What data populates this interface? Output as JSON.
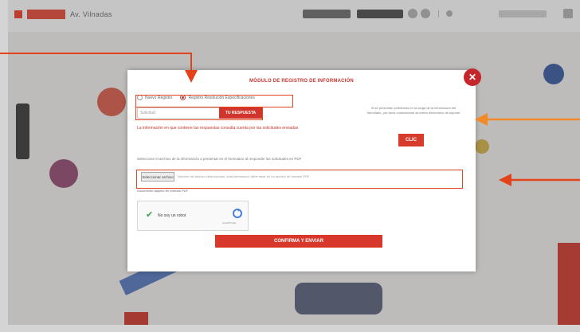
{
  "header": {
    "brand_title": "Av. Vilnadas",
    "icons": [
      "gear-icon",
      "globe-icon",
      "share-icon"
    ]
  },
  "modal": {
    "title": "MÓDULO DE REGISTRO DE INFORMACIÓN",
    "radio_options": [
      "Nuevo Registro",
      "Registro Resolución Especificaciones"
    ],
    "code_placeholder": "Solicitud",
    "code_button": "TU RESPUESTA",
    "red_note": "La información en que contiene las respuestas consulta cuenta por las solicitudes enviadas",
    "side_text": "Si se presentan problemas en la carga de la información del formulario, por favor comunicarse al correo electrónico de soporte",
    "clic_button": "CLIC",
    "description": "Seleccione el archivo de la información a presentar en el formulario al responder las solicitudes en PDF",
    "file_button": "Seleccionar archivo",
    "file_text": "Nombre del archivo seleccionado, esta información debe estar en un archivo de formato PDF",
    "file_note": "Documento adjunto en formato PDF",
    "captcha_label": "No soy un robot",
    "captcha_sub": "reCAPTCHA",
    "submit_label": "CONFIRMA Y ENVIAR",
    "close_icon": "close-icon"
  },
  "colors": {
    "accent": "#d0342a",
    "annotation": "#e2431a",
    "overlay": "#e3e0df"
  }
}
